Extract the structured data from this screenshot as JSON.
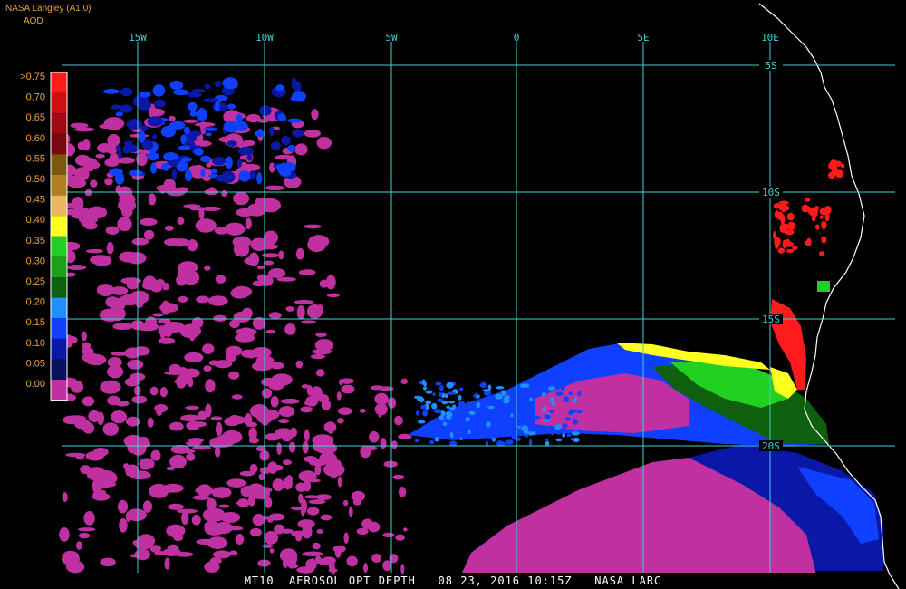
{
  "header": {
    "title": "NASA Langley (A1.0)",
    "units": "AOD"
  },
  "legend": {
    "labels": [
      ">0.75",
      "0.70",
      "0.65",
      "0.60",
      "0.55",
      "0.50",
      "0.45",
      "0.40",
      "0.35",
      "0.30",
      "0.25",
      "0.20",
      "0.15",
      "0.10",
      "0.05",
      "0.00"
    ],
    "colors": [
      "#ff1b1b",
      "#cc0f12",
      "#a00a12",
      "#7a0810",
      "#7a5810",
      "#b0801e",
      "#e8b860",
      "#ffff20",
      "#22d022",
      "#1aa01a",
      "#0e600e",
      "#1e90ff",
      "#1040ff",
      "#0a18a8",
      "#081060",
      "#c030a0"
    ]
  },
  "map": {
    "longitude_labels": [
      "15W",
      "10W",
      "5W",
      "0",
      "5E",
      "10E"
    ],
    "latitude_labels": [
      "5S",
      "10S",
      "15S",
      "20S"
    ],
    "grid_color": "#40d0d8",
    "label_color": "#40d0d8"
  },
  "footer": {
    "caption": "MT10  AEROSOL OPT DEPTH   08 23, 2016 10:15Z   NASA LARC"
  }
}
